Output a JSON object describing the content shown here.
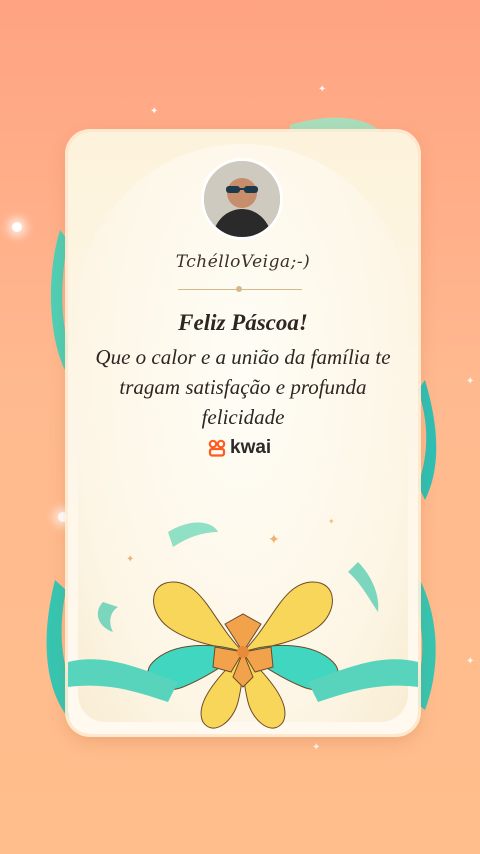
{
  "card": {
    "username": "TchélloVeiga;-)",
    "greeting": "Feliz Páscoa!",
    "message": "Que o calor e a união da família te tragam satisfação e profunda felicidade",
    "brand": "kwai"
  },
  "colors": {
    "background_top": "#ffa382",
    "background_bottom": "#ffbe8c",
    "card": "#fdf3dc",
    "brand_orange": "#ff5a1f",
    "ribbon_teal": "#40d6c0",
    "ribbon_yellow": "#f8d65a",
    "ribbon_orange": "#f2a24a"
  },
  "icons": {
    "brand_logo": "kwai-logo-icon",
    "sparkle": "sparkle-icon"
  }
}
